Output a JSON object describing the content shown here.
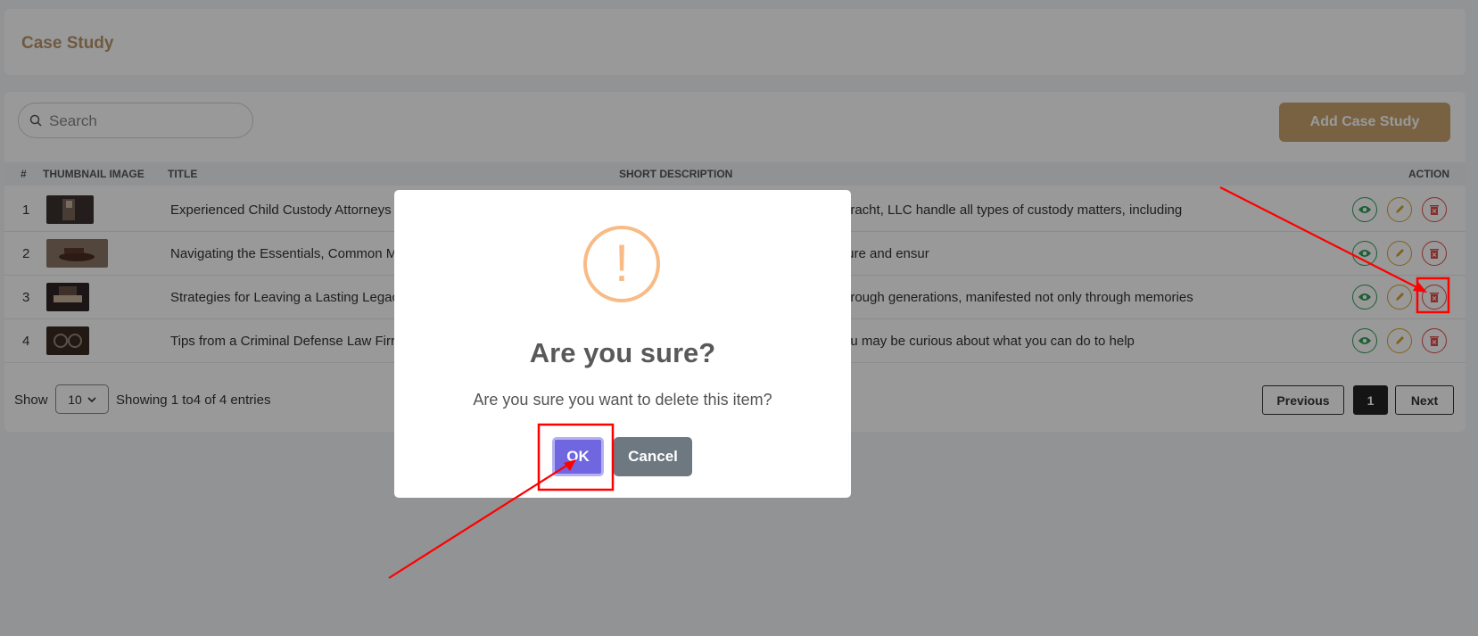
{
  "header": {
    "title": "Case Study"
  },
  "search": {
    "placeholder": "Search"
  },
  "toolbar": {
    "add_label": "Add Case Study"
  },
  "table": {
    "columns": {
      "num": "#",
      "thumb": "THUMBNAIL IMAGE",
      "title": "TITLE",
      "desc": "SHORT DESCRIPTION",
      "action": "ACTION"
    },
    "rows": [
      {
        "num": "1",
        "title": "Experienced Child Custody Attorneys",
        "desc": "bracht, LLC handle all types of custody matters, including"
      },
      {
        "num": "2",
        "title": "Navigating the Essentials, Common M",
        "desc": "ture and ensur"
      },
      {
        "num": "3",
        "title": "Strategies for Leaving a Lasting Legac",
        "desc": "hrough generations, manifested not only through memories"
      },
      {
        "num": "4",
        "title": "Tips from a Criminal Defense Law Firr",
        "desc": "ou may be curious about what you can do to help"
      }
    ]
  },
  "footer": {
    "show_label": "Show",
    "page_size": "10",
    "entries_text": "Showing 1  to4  of 4 entries",
    "prev_label": "Previous",
    "current_page": "1",
    "next_label": "Next"
  },
  "modal": {
    "icon": "!",
    "title": "Are you sure?",
    "text": "Are you sure you want to delete this item?",
    "ok_label": "OK",
    "cancel_label": "Cancel"
  },
  "colors": {
    "accent": "#c9a46e",
    "ok": "#7066e0",
    "cancel": "#6e7881",
    "warning": "#f8bb86",
    "view": "#2f9e5a",
    "edit": "#d7a32c",
    "delete": "#e34b4b",
    "annotation": "#ff0000"
  }
}
